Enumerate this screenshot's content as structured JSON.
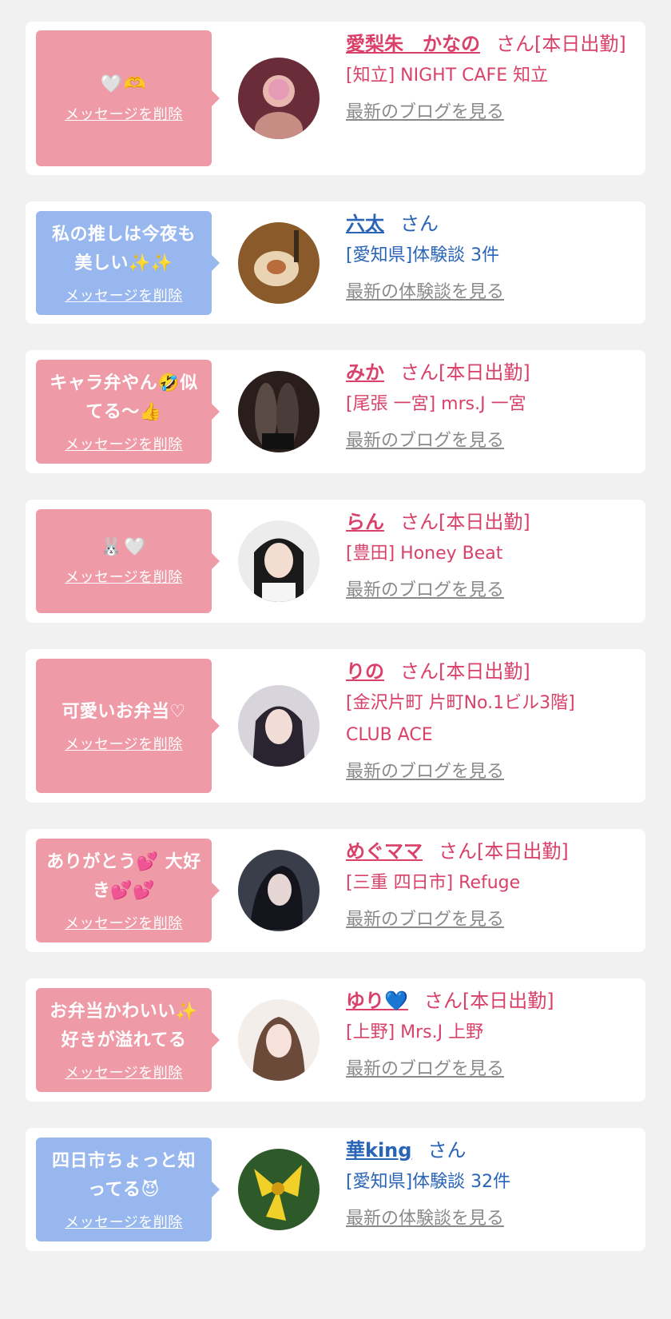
{
  "delete_label": "メッセージを削除",
  "colors": {
    "pink_bubble": "#ee9ba7",
    "blue_bubble": "#97b7ee",
    "pink_text": "#d9416a",
    "blue_text": "#2a64b7",
    "link_gray": "#8a8a8a"
  },
  "cards": [
    {
      "bubble_text": "",
      "bubble_icons": "🤍🫶",
      "name": "愛梨朱　かなの",
      "suffix": "さん[本日出勤]",
      "shop": "[知立] NIGHT CAFE 知立",
      "link": "最新のブログを見る"
    },
    {
      "bubble_text": "私の推しは今夜も美しい✨✨",
      "name": "六太",
      "suffix": "さん",
      "shop": "[愛知県]体験談 3件",
      "link": "最新の体験談を見る"
    },
    {
      "bubble_text": "キャラ弁やん🤣似てる〜👍",
      "name": "みか",
      "suffix": "さん[本日出勤]",
      "shop": "[尾張 一宮] mrs.J 一宮",
      "link": "最新のブログを見る"
    },
    {
      "bubble_text": "",
      "bubble_icons": "🐰🤍",
      "name": "らん",
      "suffix": "さん[本日出勤]",
      "shop": "[豊田] Honey Beat",
      "link": "最新のブログを見る"
    },
    {
      "bubble_text": "可愛いお弁当♡",
      "name": "りの",
      "suffix": "さん[本日出勤]",
      "shop": "[金沢片町 片町No.1ビル3階] CLUB ACE",
      "link": "最新のブログを見る"
    },
    {
      "bubble_text": "ありがとう💕 大好き💕💕",
      "name": "めぐママ",
      "suffix": "さん[本日出勤]",
      "shop": "[三重 四日市] Refuge",
      "link": "最新のブログを見る"
    },
    {
      "bubble_text": "お弁当かわいい✨好きが溢れてる",
      "name": "ゆり💙",
      "suffix": "さん[本日出勤]",
      "shop": "[上野] Mrs.J 上野",
      "link": "最新のブログを見る"
    },
    {
      "bubble_text": "四日市ちょっと知ってる😈",
      "name": "華king",
      "suffix": "さん",
      "shop": "[愛知県]体験談 32件",
      "link": "最新の体験談を見る"
    }
  ]
}
